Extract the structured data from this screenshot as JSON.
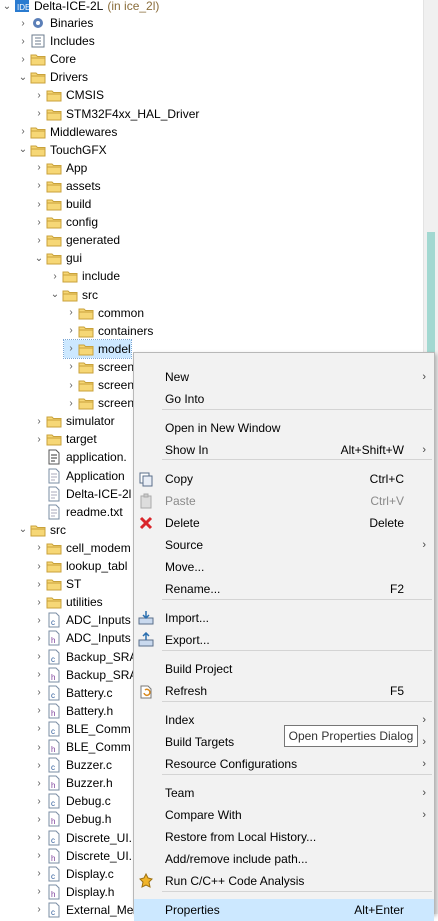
{
  "project": {
    "name": "Delta-ICE-2L",
    "suffix": "(in ice_2l)"
  },
  "tree": [
    {
      "label": "Binaries",
      "icon": "binaries-icon"
    },
    {
      "label": "Includes",
      "icon": "includes-icon"
    },
    {
      "label": "Core",
      "icon": "folder-icon"
    },
    {
      "label": "Drivers",
      "icon": "folder-icon"
    },
    {
      "label": "CMSIS",
      "icon": "folder-icon"
    },
    {
      "label": "STM32F4xx_HAL_Driver",
      "icon": "folder-icon"
    },
    {
      "label": "Middlewares",
      "icon": "folder-icon"
    },
    {
      "label": "TouchGFX",
      "icon": "folder-icon"
    },
    {
      "label": "App",
      "icon": "folder-icon"
    },
    {
      "label": "assets",
      "icon": "folder-icon"
    },
    {
      "label": "build",
      "icon": "folder-icon"
    },
    {
      "label": "config",
      "icon": "folder-icon"
    },
    {
      "label": "generated",
      "icon": "folder-icon"
    },
    {
      "label": "gui",
      "icon": "folder-icon"
    },
    {
      "label": "include",
      "icon": "folder-icon"
    },
    {
      "label": "src",
      "icon": "folder-icon"
    },
    {
      "label": "common",
      "icon": "folder-icon"
    },
    {
      "label": "containers",
      "icon": "folder-icon"
    },
    {
      "label": "model",
      "icon": "folder-icon"
    },
    {
      "label": "screen",
      "icon": "folder-icon"
    },
    {
      "label": "screen",
      "icon": "folder-icon"
    },
    {
      "label": "screen",
      "icon": "folder-icon"
    },
    {
      "label": "simulator",
      "icon": "folder-icon"
    },
    {
      "label": "target",
      "icon": "folder-icon"
    },
    {
      "label": "application.",
      "icon": "app-file-icon"
    },
    {
      "label": "Application",
      "icon": "file-icon"
    },
    {
      "label": "Delta-ICE-2l",
      "icon": "file-icon"
    },
    {
      "label": "readme.txt",
      "icon": "file-icon"
    },
    {
      "label": "src",
      "icon": "folder-icon"
    },
    {
      "label": "cell_modem",
      "icon": "folder-icon"
    },
    {
      "label": "lookup_tabl",
      "icon": "folder-icon"
    },
    {
      "label": "ST",
      "icon": "folder-icon"
    },
    {
      "label": "utilities",
      "icon": "folder-icon"
    },
    {
      "label": "ADC_Inputs",
      "icon": "c-file-icon"
    },
    {
      "label": "ADC_Inputs",
      "icon": "h-file-icon"
    },
    {
      "label": "Backup_SRA",
      "icon": "c-file-icon"
    },
    {
      "label": "Backup_SRA",
      "icon": "h-file-icon"
    },
    {
      "label": "Battery.c",
      "icon": "c-file-icon"
    },
    {
      "label": "Battery.h",
      "icon": "h-file-icon"
    },
    {
      "label": "BLE_Comm",
      "icon": "c-file-icon"
    },
    {
      "label": "BLE_Comm",
      "icon": "h-file-icon"
    },
    {
      "label": "Buzzer.c",
      "icon": "c-file-icon"
    },
    {
      "label": "Buzzer.h",
      "icon": "h-file-icon"
    },
    {
      "label": "Debug.c",
      "icon": "c-file-icon"
    },
    {
      "label": "Debug.h",
      "icon": "h-file-icon"
    },
    {
      "label": "Discrete_UI.",
      "icon": "c-file-icon"
    },
    {
      "label": "Discrete_UI.",
      "icon": "h-file-icon"
    },
    {
      "label": "Display.c",
      "icon": "c-file-icon"
    },
    {
      "label": "Display.h",
      "icon": "h-file-icon"
    },
    {
      "label": "External_Me",
      "icon": "c-file-icon"
    }
  ],
  "menu": [
    {
      "label": "New",
      "shortcut": "",
      "submenu": true,
      "icon": ""
    },
    {
      "label": "Go Into",
      "shortcut": "",
      "submenu": false,
      "icon": ""
    },
    {
      "label": "Open in New Window",
      "shortcut": "",
      "submenu": false,
      "icon": ""
    },
    {
      "label": "Show In",
      "shortcut": "Alt+Shift+W",
      "submenu": true,
      "icon": ""
    },
    {
      "label": "Copy",
      "shortcut": "Ctrl+C",
      "submenu": false,
      "icon": "copy-icon"
    },
    {
      "label": "Paste",
      "shortcut": "Ctrl+V",
      "submenu": false,
      "icon": "paste-icon",
      "disabled": true
    },
    {
      "label": "Delete",
      "shortcut": "Delete",
      "submenu": false,
      "icon": "delete-icon"
    },
    {
      "label": "Source",
      "shortcut": "",
      "submenu": true,
      "icon": ""
    },
    {
      "label": "Move...",
      "shortcut": "",
      "submenu": false,
      "icon": ""
    },
    {
      "label": "Rename...",
      "shortcut": "F2",
      "submenu": false,
      "icon": ""
    },
    {
      "label": "Import...",
      "shortcut": "",
      "submenu": false,
      "icon": "import-icon"
    },
    {
      "label": "Export...",
      "shortcut": "",
      "submenu": false,
      "icon": "export-icon"
    },
    {
      "label": "Build Project",
      "shortcut": "",
      "submenu": false,
      "icon": ""
    },
    {
      "label": "Refresh",
      "shortcut": "F5",
      "submenu": false,
      "icon": "refresh-icon"
    },
    {
      "label": "Index",
      "shortcut": "",
      "submenu": true,
      "icon": ""
    },
    {
      "label": "Build Targets",
      "shortcut": "",
      "submenu": true,
      "icon": ""
    },
    {
      "label": "Resource Configurations",
      "shortcut": "",
      "submenu": true,
      "icon": ""
    },
    {
      "label": "Team",
      "shortcut": "",
      "submenu": true,
      "icon": ""
    },
    {
      "label": "Compare With",
      "shortcut": "",
      "submenu": true,
      "icon": ""
    },
    {
      "label": "Restore from Local History...",
      "shortcut": "",
      "submenu": false,
      "icon": ""
    },
    {
      "label": "Add/remove include path...",
      "shortcut": "",
      "submenu": false,
      "icon": ""
    },
    {
      "label": "Run C/C++ Code Analysis",
      "shortcut": "",
      "submenu": false,
      "icon": "analysis-icon"
    },
    {
      "label": "Properties",
      "shortcut": "Alt+Enter",
      "submenu": false,
      "icon": "",
      "highlighted": true
    }
  ],
  "tooltip": "Open Properties Dialog"
}
